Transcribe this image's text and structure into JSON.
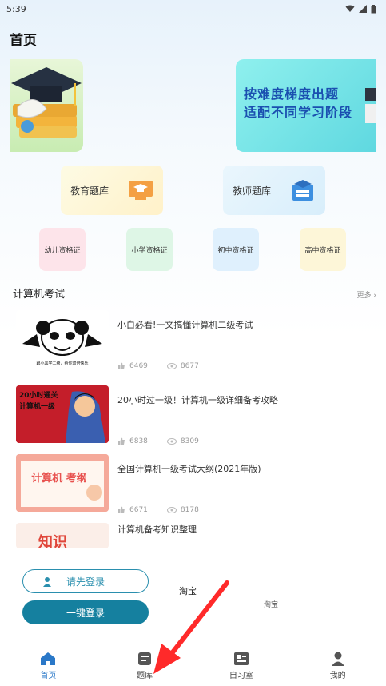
{
  "status_bar": {
    "time": "5:39"
  },
  "page": {
    "title": "首页"
  },
  "banner": {
    "text_line1": "按难度梯度出题",
    "text_line2": "适配不同学习阶段"
  },
  "cards": {
    "edu": "教育题库",
    "teacher": "教师题库"
  },
  "certs": [
    "幼儿资格证",
    "小学资格证",
    "初中资格证",
    "高中资格证"
  ],
  "section": {
    "title": "计算机考试",
    "more": "更多"
  },
  "articles": [
    {
      "title": "小白必看!一文搞懂计算机二级考试",
      "likes": "6469",
      "views": "8677",
      "thumb_caption": "跟小黑学二级，给你双倍快乐"
    },
    {
      "title": "20小时过一级！计算机一级详细备考攻略",
      "likes": "6838",
      "views": "8309",
      "thumb_caption": "20小时通关 计算机一级"
    },
    {
      "title": "全国计算机一级考试大纲(2021年版)",
      "likes": "6671",
      "views": "8178",
      "thumb_caption": "计算机 考纲"
    },
    {
      "title": "计算机备考知识整理",
      "thumb_caption": "知识"
    }
  ],
  "login": {
    "prompt": "请先登录",
    "one_click": "一键登录"
  },
  "taobao": {
    "label1": "淘宝",
    "label2": "淘宝"
  },
  "nav": [
    {
      "label": "首页",
      "icon": "home-icon",
      "active": true
    },
    {
      "label": "题库",
      "icon": "question-bank-icon",
      "active": false
    },
    {
      "label": "自习室",
      "icon": "study-room-icon",
      "active": false
    },
    {
      "label": "我的",
      "icon": "profile-icon",
      "active": false
    }
  ],
  "colors": {
    "accent": "#15809f",
    "nav_active": "#2a78c8",
    "annotation_arrow": "#ff2a2a"
  }
}
